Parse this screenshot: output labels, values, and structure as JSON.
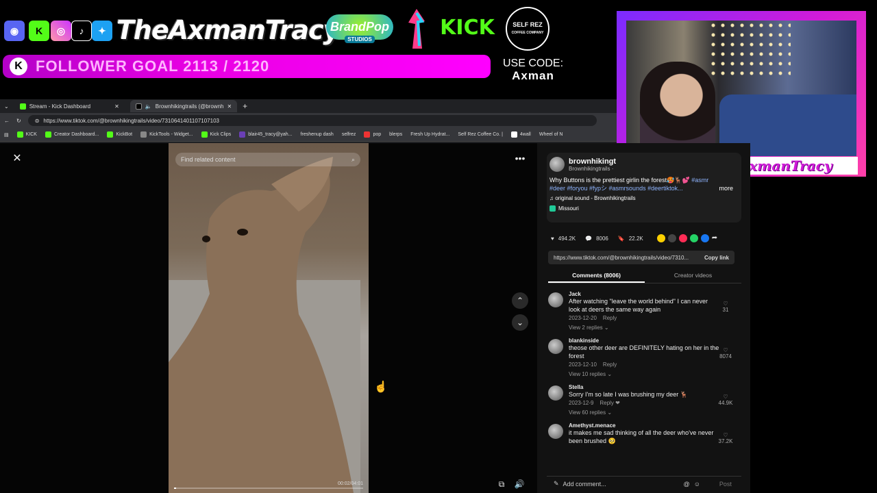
{
  "overlay": {
    "brand": "TheAxmanTracy",
    "goal_text": "FOLLOWER GOAL 2113 / 2120",
    "brandpop_line1": "BrandPop",
    "brandpop_line2": "STUDIOS",
    "kick_logo": "KICK",
    "selfrez_line1": "SELF REZ",
    "selfrez_line2": "COFFEE COMPANY",
    "use_code_label": "USE CODE:",
    "use_code_value": "Axman",
    "cam_name": "TheAxmanTracy"
  },
  "browser": {
    "tabs": [
      {
        "label": "Stream - Kick Dashboard",
        "active": false
      },
      {
        "label": "Brownhikingtrails (@brownh",
        "active": true
      }
    ],
    "url": "https://www.tiktok.com/@brownhikingtrails/video/7310641401107107103",
    "bookmarks": [
      "KICK",
      "Creator Dashboard...",
      "KickBot",
      "KickTools - Widget...",
      "Kick Clips",
      "blair45_tracy@yah...",
      "freshenup dash",
      "selfrez",
      "pop",
      "blerps",
      "Fresh Up Hydrat...",
      "Self Rez Coffee Co. |",
      "4wall",
      "Wheel of N"
    ]
  },
  "player": {
    "find_placeholder": "Find related content",
    "time": "00:02/04:01"
  },
  "post": {
    "author": "brownhikingt",
    "author_sub": "Brownhikingtrails ·",
    "desc_plain": "Why Buttons is the prettiest girlin the forest🥵🦌💕",
    "desc_tags1": "#asmr",
    "desc_tags2": "#deer #foryou #fypシ #asmrsounds #deertiktok...",
    "more": "more",
    "sound": "original sound - Brownhikingtrails",
    "location": "Missouri",
    "likes": "494.2K",
    "comments": "8006",
    "saves": "22.2K",
    "link": "https://www.tiktok.com/@brownhikingtrails/video/7310...",
    "copy_link": "Copy link",
    "tab_comments": "Comments (8006)",
    "tab_creator": "Creator videos",
    "add_comment": "Add comment...",
    "post_btn": "Post"
  },
  "comments": [
    {
      "name": "Jack",
      "text": "After watching \"leave the world behind\" I can never look at deers the same way again",
      "date": "2023-12-20",
      "reply": "Reply",
      "replies": "View 2 replies",
      "likes": "31"
    },
    {
      "name": "blankinside",
      "text": "theose other deer are DEFINITELY hating on her in the forest",
      "date": "2023-12-10",
      "reply": "Reply",
      "replies": "View 10 replies",
      "likes": "8074"
    },
    {
      "name": "Stella",
      "text": "Sorry I'm so late I was brushing my deer 🦌",
      "date": "2023-12-9",
      "reply": "Reply",
      "replies": "View 60 replies",
      "likes": "44.9K"
    },
    {
      "name": "Amethyst.menace",
      "text": "it makes me sad thinking of all the deer who've never been brushed 🥺",
      "date": "",
      "reply": "",
      "replies": "",
      "likes": "37.2K"
    }
  ],
  "colors": {
    "accent": "#e900e3",
    "kick_green": "#53fc18",
    "link": "#8fb5ff"
  }
}
